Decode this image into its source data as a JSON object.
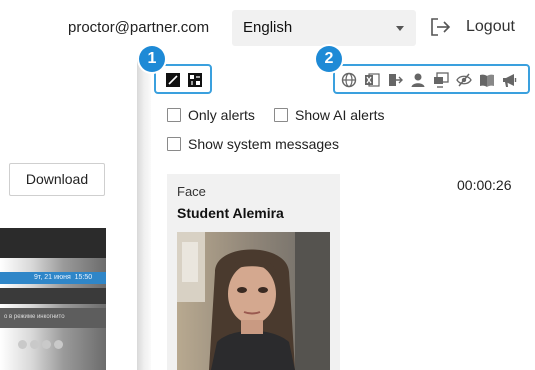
{
  "header": {
    "email": "proctor@partner.com",
    "language": "English",
    "logout_label": "Logout"
  },
  "left_pane": {
    "download_label": "Download",
    "preview": {
      "date_text": "9т, 21 июня",
      "time_text": "15:50",
      "incognito_text": "о в режиме инкогнито"
    }
  },
  "callouts": [
    "1",
    "2"
  ],
  "toolbar": {
    "left_icons": [
      "pen-icon",
      "grid-icon"
    ],
    "right_icons": [
      "globe-icon",
      "excel-icon",
      "door-exit-icon",
      "person-icon",
      "screen-share-icon",
      "eye-off-icon",
      "book-icon",
      "megaphone-icon"
    ]
  },
  "filters": {
    "only_alerts": "Only alerts",
    "show_ai_alerts": "Show AI alerts",
    "show_system_messages": "Show system messages"
  },
  "event": {
    "type": "Face",
    "student": "Student Alemira",
    "time": "00:00:26"
  },
  "colors": {
    "accent": "#1e8ad6",
    "highlight_border": "#3aa0de"
  }
}
